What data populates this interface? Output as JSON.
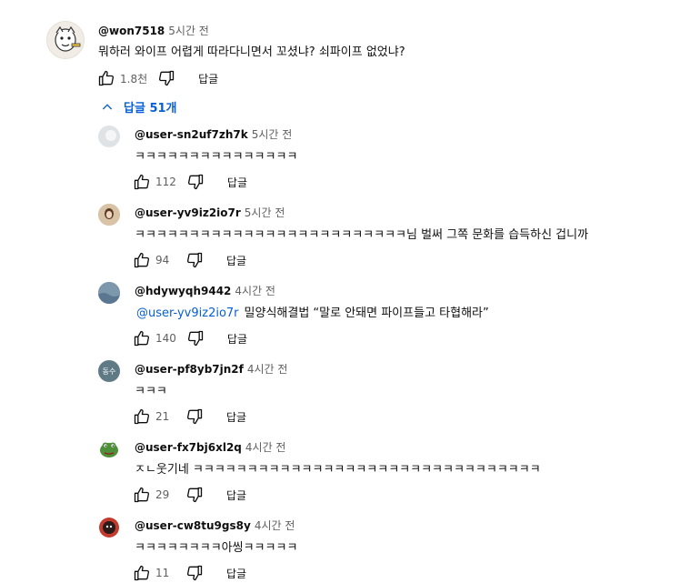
{
  "top_comment": {
    "author": "@won7518",
    "time": "5시간 전",
    "text": "뭐하러 와이프 어렵게 따라다니면서 꼬셨냐? 쇠파이프 없었냐?",
    "likes": "1.8천",
    "reply_label": "답글"
  },
  "replies_toggle": {
    "label": "답글 51개"
  },
  "replies": [
    {
      "author": "@user-sn2uf7zh7k",
      "time": "5시간 전",
      "mention": "",
      "text": "ㅋㅋㅋㅋㅋㅋㅋㅋㅋㅋㅋㅋㅋㅋㅋ",
      "likes": "112",
      "reply_label": "답글"
    },
    {
      "author": "@user-yv9iz2io7r",
      "time": "5시간 전",
      "mention": "",
      "text": "ㅋㅋㅋㅋㅋㅋㅋㅋㅋㅋㅋㅋㅋㅋㅋㅋㅋㅋㅋㅋㅋㅋㅋㅋㅋ님 벌써 그쪽 문화를 습득하신 겁니까",
      "likes": "94",
      "reply_label": "답글"
    },
    {
      "author": "@hdywyqh9442",
      "time": "4시간 전",
      "mention": "@user-yv9iz2io7r",
      "text": "밀양식해결법 “말로 안돼면 파이프들고 타협해라”",
      "likes": "140",
      "reply_label": "답글"
    },
    {
      "author": "@user-pf8yb7jn2f",
      "time": "4시간 전",
      "mention": "",
      "text": "ㅋㅋㅋ",
      "likes": "21",
      "reply_label": "답글",
      "avatar_text": "동수"
    },
    {
      "author": "@user-fx7bj6xl2q",
      "time": "4시간 전",
      "mention": "",
      "text": "ㅈㄴ웃기네 ㅋㅋㅋㅋㅋㅋㅋㅋㅋㅋㅋㅋㅋㅋㅋㅋㅋㅋㅋㅋㅋㅋㅋㅋㅋㅋㅋㅋㅋㅋㅋㅋ",
      "likes": "29",
      "reply_label": "답글"
    },
    {
      "author": "@user-cw8tu9gs8y",
      "time": "4시간 전",
      "mention": "",
      "text": "ㅋㅋㅋㅋㅋㅋㅋㅋ아씽ㅋㅋㅋㅋㅋ",
      "likes": "11",
      "reply_label": "답글"
    }
  ],
  "colors": {
    "link": "#065fd4",
    "secondary_text": "#606060",
    "primary_text": "#0f0f0f"
  },
  "icons": [
    "thumb-up-icon",
    "thumb-down-icon",
    "chevron-up-icon"
  ]
}
